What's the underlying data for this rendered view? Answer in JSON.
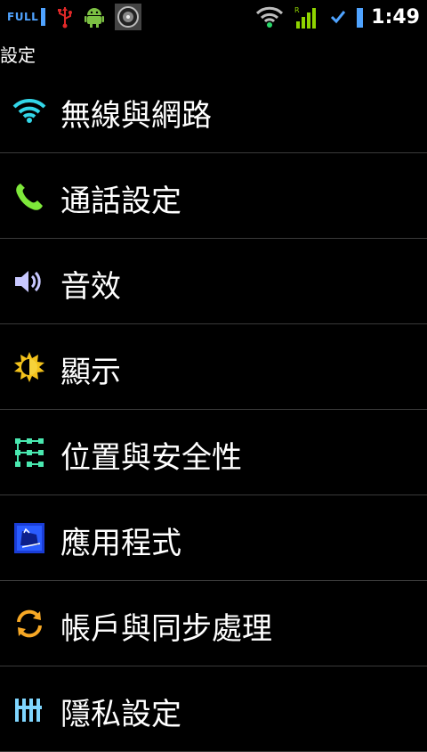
{
  "statusbar": {
    "full_label": "FULL",
    "time": "1:49",
    "icons": [
      "usb-icon",
      "android-debug-icon",
      "media-app-icon",
      "wifi-icon",
      "signal-icon",
      "sync-check-icon",
      "battery-icon"
    ]
  },
  "header": {
    "title": "設定"
  },
  "menu": {
    "items": [
      {
        "label": "無線與網路",
        "icon": "wifi-icon"
      },
      {
        "label": "通話設定",
        "icon": "phone-icon"
      },
      {
        "label": "音效",
        "icon": "speaker-icon"
      },
      {
        "label": "顯示",
        "icon": "brightness-icon"
      },
      {
        "label": "位置與安全性",
        "icon": "location-security-icon"
      },
      {
        "label": "應用程式",
        "icon": "applications-icon"
      },
      {
        "label": "帳戶與同步處理",
        "icon": "sync-icon"
      },
      {
        "label": "隱私設定",
        "icon": "privacy-icon"
      }
    ]
  },
  "colors": {
    "background": "#000000",
    "divider": "#3a3a3a",
    "accent_blue": "#4fa3ff",
    "wifi": "#33d6e8",
    "phone": "#7ee83a",
    "signal": "#8fd400"
  }
}
